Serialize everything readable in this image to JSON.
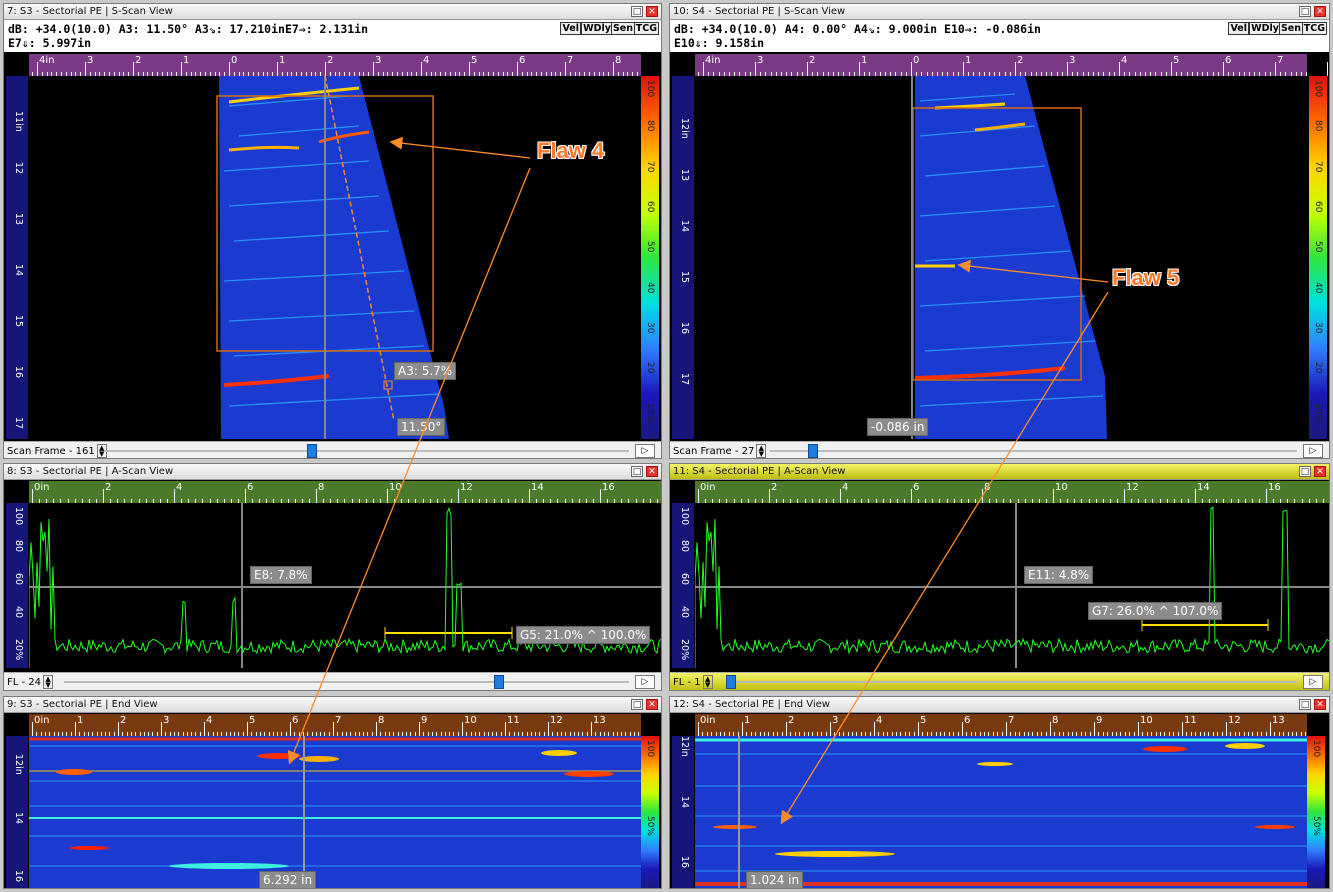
{
  "panels": {
    "p7": {
      "title": "7: S3 - Sectorial PE | S-Scan View",
      "info1": "dB: +34.0(10.0)  A3: 11.50°  A3⇘: 17.210inE7⇒: 2.131in",
      "info2": "E7⇓: 5.997in",
      "callout_a": "A3: 5.7%",
      "callout_b": "11.50°",
      "scroll": "Scan Frame - 161"
    },
    "p10": {
      "title": "10: S4 - Sectorial PE | S-Scan View",
      "info1": "dB: +34.0(10.0)  A4: 0.00°   A4⇘: 9.000in  E10⇒: -0.086in",
      "info2": "E10⇓: 9.158in",
      "callout_a": "-0.086 in",
      "scroll": "Scan Frame - 27"
    },
    "p8": {
      "title": "8: S3 - Sectorial PE | A-Scan View",
      "callout_a": "E8: 7.8%",
      "callout_b": "G5: 21.0% ^ 100.0%",
      "scroll": "FL - 24"
    },
    "p11": {
      "title": "11: S4 - Sectorial PE | A-Scan View",
      "callout_a": "E11: 4.8%",
      "callout_b": "G7: 26.0% ^ 107.0%",
      "scroll": "FL - 1"
    },
    "p9": {
      "title": "9: S3 - Sectorial PE | End View",
      "callout_a": "6.292 in"
    },
    "p12": {
      "title": "12: S4 - Sectorial PE | End View",
      "callout_a": "1.024 in"
    }
  },
  "toggles": [
    "Vel",
    "WDly",
    "Sen",
    "TCG"
  ],
  "flaws": {
    "f4": "Flaw 4",
    "f5": "Flaw 5"
  },
  "sscan_ruler": [
    "4in",
    "3",
    "2",
    "1",
    "0",
    "1",
    "2",
    "3",
    "4",
    "5",
    "6",
    "7",
    "8"
  ],
  "ascan_ruler": [
    "0in",
    "2",
    "4",
    "6",
    "8",
    "10",
    "12",
    "14",
    "16"
  ],
  "end_ruler": [
    "0in",
    "1",
    "2",
    "3",
    "4",
    "5",
    "6",
    "7",
    "8",
    "9",
    "10",
    "11",
    "12",
    "13"
  ],
  "sscan_depth_left": [
    "11in",
    "12",
    "13",
    "14",
    "15",
    "16",
    "17"
  ],
  "sscan_depth_right": [
    "12in",
    "13",
    "14",
    "15",
    "16",
    "17"
  ],
  "ascan_amp": [
    "100",
    "80",
    "60",
    "40",
    "20%"
  ],
  "end_depth": [
    "12in",
    "14",
    "16"
  ],
  "cbar_labels": [
    "100",
    "80",
    "70",
    "60",
    "50",
    "40",
    "30",
    "20",
    "10%"
  ],
  "end_cbar_labels": [
    "100",
    "50%"
  ],
  "colors": {
    "ruler_purple": "#7a3a86",
    "ruler_green": "#4a7a2a",
    "ruler_brown": "#7a3a10",
    "accent_orange": "#ff7a2a"
  }
}
